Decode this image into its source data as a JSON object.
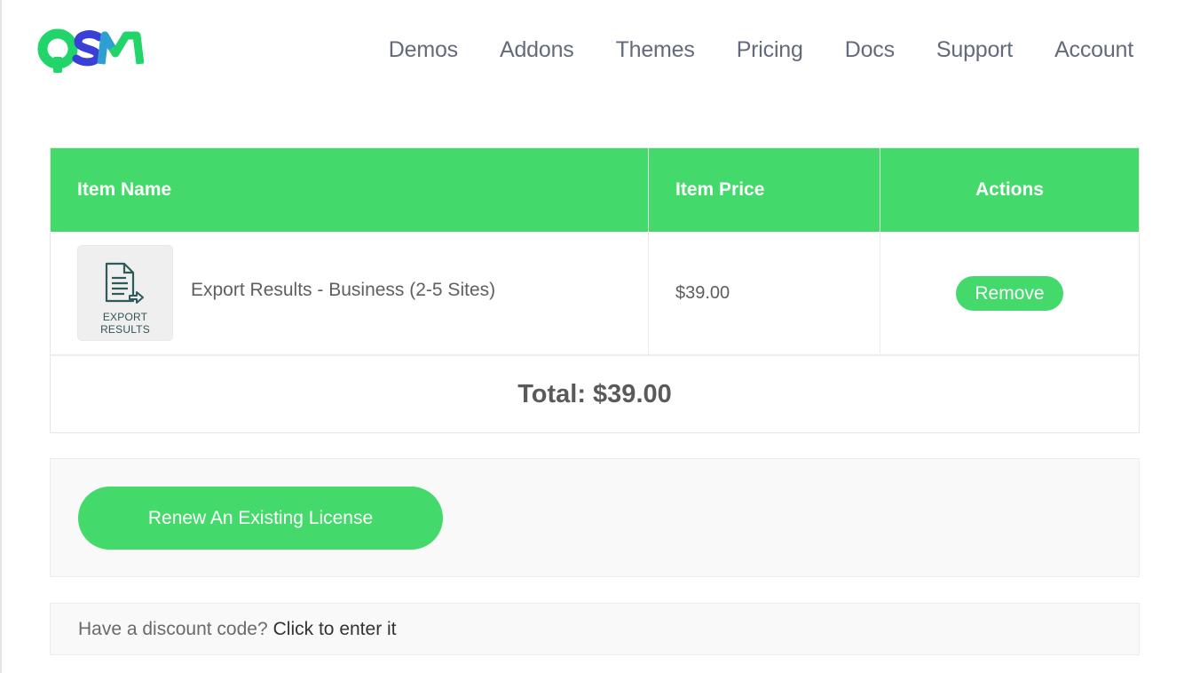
{
  "brand": {
    "logo_text": "QSM",
    "colors": {
      "green": "#44d96b",
      "blue": "#3a4fd8",
      "teal": "#2d9fd0"
    }
  },
  "nav": {
    "items": [
      {
        "label": "Demos"
      },
      {
        "label": "Addons"
      },
      {
        "label": "Themes"
      },
      {
        "label": "Pricing"
      },
      {
        "label": "Docs"
      },
      {
        "label": "Support"
      },
      {
        "label": "Account"
      }
    ]
  },
  "cart": {
    "headers": {
      "name": "Item Name",
      "price": "Item Price",
      "actions": "Actions"
    },
    "items": [
      {
        "thumb_label": "EXPORT RESULTS",
        "thumb_icon": "document-export-icon",
        "name": "Export Results - Business (2-5 Sites)",
        "price": "$39.00",
        "action_label": "Remove"
      }
    ],
    "total": "Total: $39.00"
  },
  "renew": {
    "button_label": "Renew An Existing License"
  },
  "discount": {
    "prompt": "Have a discount code?",
    "link": "Click to enter it"
  },
  "theme": {
    "accent": "#44d96b",
    "text": "#555555",
    "panel_bg": "#f9f9f9"
  }
}
